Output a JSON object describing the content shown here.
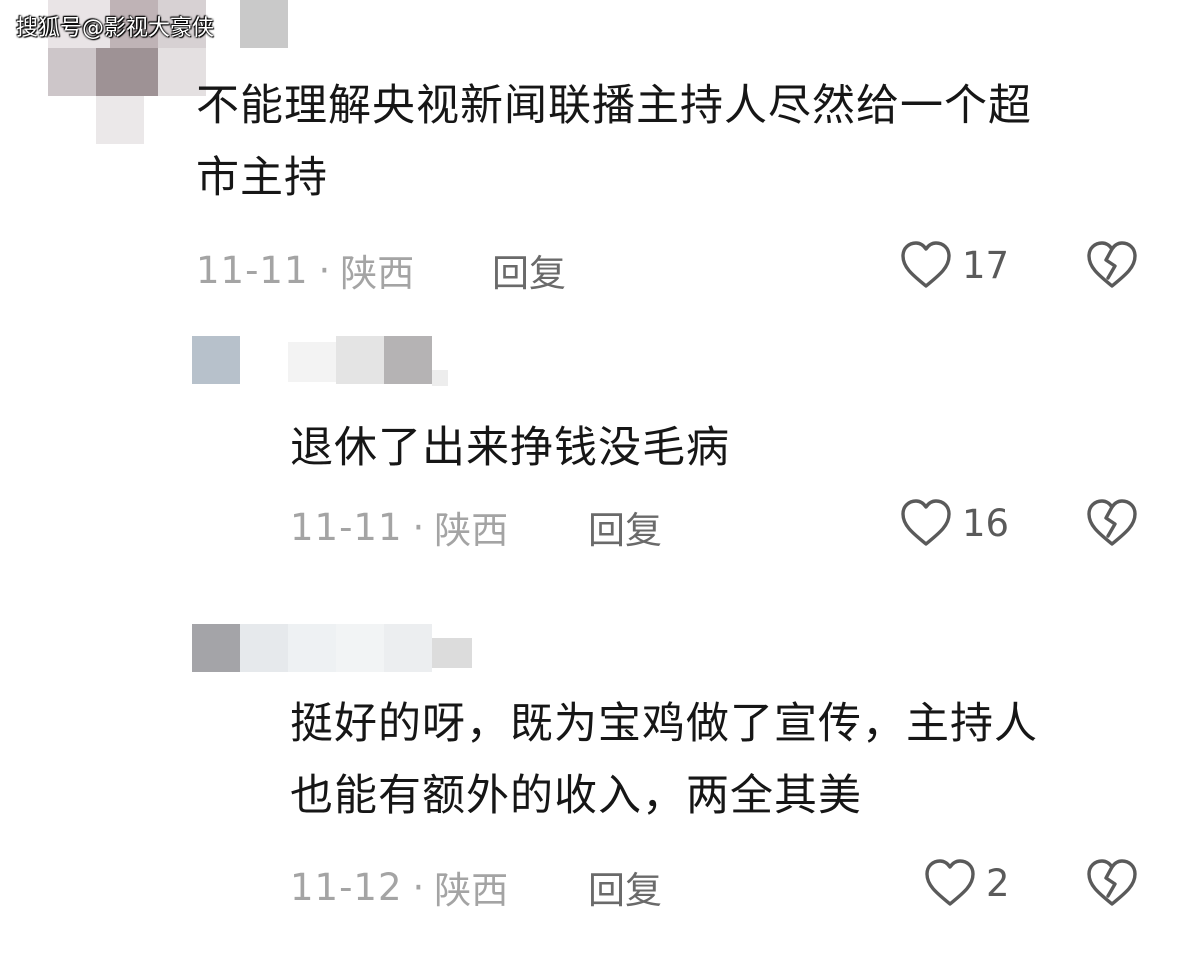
{
  "watermark": "搜狐号@影视大豪侠",
  "comments": [
    {
      "text_lines": [
        "不能理解央视新闻联播主持人尽然给一个超",
        "市主持"
      ],
      "date": "11-11",
      "location": "陕西",
      "reply_label": "回复",
      "likes": "17",
      "like_icon": "heart-outline-icon",
      "dislike_icon": "broken-heart-icon"
    },
    {
      "text_lines": [
        "退休了出来挣钱没毛病"
      ],
      "date": "11-11",
      "location": "陕西",
      "reply_label": "回复",
      "likes": "16",
      "like_icon": "heart-outline-icon",
      "dislike_icon": "broken-heart-icon"
    },
    {
      "text_lines": [
        "挺好的呀，既为宝鸡做了宣传，主持人",
        "也能有额外的收入，两全其美"
      ],
      "date": "11-12",
      "location": "陕西",
      "reply_label": "回复",
      "likes": "2",
      "like_icon": "heart-outline-icon",
      "dislike_icon": "broken-heart-icon"
    }
  ],
  "separator": "·",
  "colors": {
    "text": "#161616",
    "meta": "#a4a4a4",
    "reply": "#6a6a6a",
    "icon": "#5a5a5a"
  }
}
